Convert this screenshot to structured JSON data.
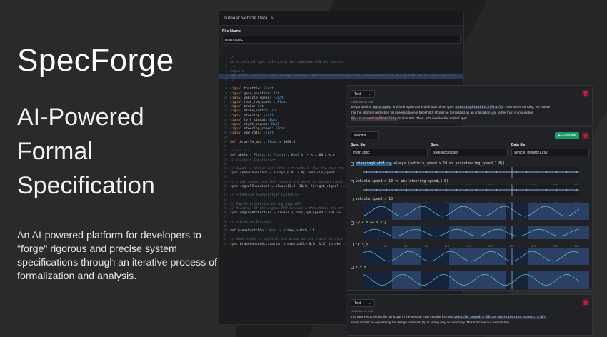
{
  "hero": {
    "title": "SpecForge",
    "tagline_lines": [
      "AI-Powered",
      "Formal",
      "Specification"
    ],
    "description": "An AI-powered platform for developers to \"forge\" rigorous and precise system specifications through an iterative process of formalization and analysis."
  },
  "editor": {
    "tab_title": "Tutorial: Vehicle Data",
    "file_name_label": "File Name",
    "file_name_value": "main.spec",
    "code_lines": [
      {
        "n": "1",
        "parts": [
          [
            "cm",
            "/*"
          ]
        ]
      },
      {
        "n": "2",
        "parts": [
          [
            "cm",
            "An artificial spec file using the nuScenes CAN bus dataset."
          ]
        ]
      },
      {
        "n": "3",
        "parts": [
          [
            "cm",
            "..."
          ]
        ]
      },
      {
        "n": "4",
        "parts": [
          [
            "cm",
            "Signals"
          ]
        ]
      },
      {
        "n": "5",
        "parts": [
          [
            "cm",
            "see https://github.com/nutonomy/nuscenes-devkit/blob/master/python-sdk/nuscenes/can_bus/README.md for more details"
          ]
        ],
        "hl": true
      },
      {
        "n": "6",
        "parts": [
          [
            "cm",
            "*/"
          ]
        ]
      },
      {
        "n": "7",
        "parts": [
          [
            "tx",
            ""
          ]
        ]
      },
      {
        "n": "8",
        "parts": [
          [
            "kw",
            "signal "
          ],
          [
            "tx",
            "throttle: "
          ],
          [
            "ty",
            "Float"
          ]
        ]
      },
      {
        "n": "9",
        "parts": [
          [
            "kw",
            "signal "
          ],
          [
            "tx",
            "gear_position: "
          ],
          [
            "ty",
            "Int"
          ]
        ]
      },
      {
        "n": "10",
        "parts": [
          [
            "kw",
            "signal "
          ],
          [
            "tx",
            "vehicle_speed: "
          ],
          [
            "ty",
            "Float"
          ]
        ]
      },
      {
        "n": "11",
        "parts": [
          [
            "kw",
            "signal "
          ],
          [
            "tx",
            "rear_rpm_speed : "
          ],
          [
            "ty",
            "Float"
          ]
        ]
      },
      {
        "n": "12",
        "parts": [
          [
            "kw",
            "signal "
          ],
          [
            "tx",
            "brake: "
          ],
          [
            "ty",
            "Int"
          ]
        ]
      },
      {
        "n": "13",
        "parts": [
          [
            "kw",
            "signal "
          ],
          [
            "tx",
            "brake_switch: "
          ],
          [
            "ty",
            "Int"
          ]
        ]
      },
      {
        "n": "14",
        "parts": [
          [
            "kw",
            "signal "
          ],
          [
            "tx",
            "steering: "
          ],
          [
            "ty",
            "Float"
          ]
        ]
      },
      {
        "n": "15",
        "parts": [
          [
            "kw",
            "signal "
          ],
          [
            "tx",
            "left_signal: "
          ],
          [
            "ty",
            "Bool"
          ]
        ]
      },
      {
        "n": "16",
        "parts": [
          [
            "kw",
            "signal "
          ],
          [
            "tx",
            "right_signal: "
          ],
          [
            "ty",
            "Bool"
          ]
        ]
      },
      {
        "n": "17",
        "parts": [
          [
            "kw",
            "signal "
          ],
          [
            "tx",
            "steering_speed: "
          ],
          [
            "ty",
            "Float"
          ]
        ]
      },
      {
        "n": "18",
        "parts": [
          [
            "kw",
            "signal "
          ],
          [
            "tx",
            "yaw_rate: "
          ],
          [
            "ty",
            "Float"
          ]
        ]
      },
      {
        "n": "19",
        "parts": [
          [
            "tx",
            ""
          ]
        ]
      },
      {
        "n": "20",
        "parts": [
          [
            "kw",
            "def "
          ],
          [
            "tx",
            "throttle_max : "
          ],
          [
            "ty",
            "Float"
          ],
          [
            "tx",
            " = 1000.0"
          ]
        ]
      },
      {
        "n": "21",
        "parts": [
          [
            "tx",
            ""
          ]
        ]
      },
      {
        "n": "22",
        "parts": [
          [
            "cm",
            "// lcf = x"
          ]
        ]
      },
      {
        "n": "23",
        "parts": [
          [
            "kw",
            "def "
          ],
          [
            "tx",
            "abslx : "
          ],
          [
            "ty",
            "Float"
          ],
          [
            "tx",
            ", y: "
          ],
          [
            "ty",
            "Float"
          ],
          [
            "tx",
            ") : "
          ],
          [
            "ty",
            "Bool"
          ],
          [
            "tx",
            " = -y < x && x < y"
          ]
        ]
      },
      {
        "n": "24",
        "parts": [
          [
            "cm",
            "// <<Simple Invariant>>"
          ]
        ]
      },
      {
        "n": "25",
        "parts": [
          [
            "tx",
            ""
          ]
        ]
      },
      {
        "n": "26",
        "parts": [
          [
            "cm",
            "// Speed is always less than a threshold, for the next ten..."
          ]
        ]
      },
      {
        "n": "27",
        "parts": [
          [
            "kw",
            "spec "
          ],
          [
            "tx",
            "speedInvariant = always[0.0, 2.0] (vehicle_speed ..."
          ]
        ]
      },
      {
        "n": "28",
        "parts": [
          [
            "tx",
            ""
          ]
        ]
      },
      {
        "n": "29",
        "parts": [
          [
            "cm",
            "// right signal and left signal are never triggered simult..."
          ]
        ]
      },
      {
        "n": "30",
        "parts": [
          [
            "kw",
            "spec "
          ],
          [
            "tx",
            "signalInvariant = always[0.0, 10.0] !(right_signal ..."
          ]
        ]
      },
      {
        "n": "31",
        "parts": [
          [
            "tx",
            ""
          ]
        ]
      },
      {
        "n": "32",
        "parts": [
          [
            "cm",
            "// <<Vehicle Acceleration Control>>"
          ]
        ]
      },
      {
        "n": "33",
        "parts": [
          [
            "tx",
            ""
          ]
        ]
      },
      {
        "n": "34",
        "parts": [
          [
            "cm",
            "// Engine Protection During High RPM"
          ]
        ]
      },
      {
        "n": "35",
        "parts": [
          [
            "cm",
            "// Meaning: If the engine RPM exceeds a threshold, the thr..."
          ]
        ]
      },
      {
        "n": "36",
        "parts": [
          [
            "kw",
            "spec "
          ],
          [
            "tx",
            "engineProtection = always ((rear_rpm_speed > 10) =>..."
          ]
        ]
      },
      {
        "n": "37",
        "parts": [
          [
            "tx",
            ""
          ]
        ]
      },
      {
        "n": "38",
        "parts": [
          [
            "cm",
            "// <<Braking System>>"
          ]
        ]
      },
      {
        "n": "39",
        "parts": [
          [
            "tx",
            ""
          ]
        ]
      },
      {
        "n": "40",
        "parts": [
          [
            "kw",
            "def "
          ],
          [
            "tx",
            "breakSwitchOn : "
          ],
          [
            "ty",
            "Bool"
          ],
          [
            "tx",
            " = brake_switch : 1"
          ]
        ]
      },
      {
        "n": "41",
        "parts": [
          [
            "tx",
            ""
          ]
        ]
      },
      {
        "n": "42",
        "parts": [
          [
            "cm",
            "// When brake is applied, the brake switch status is also ..."
          ]
        ]
      },
      {
        "n": "43",
        "parts": [
          [
            "kw",
            "spec "
          ],
          [
            "tx",
            "brakeSensorActivation = eventually[0.0, 1.0] (brake ..."
          ]
        ]
      }
    ]
  },
  "text_panel_1": {
    "mode": "Text",
    "hint": "(Click Text to Edit)",
    "line1_a": "We go back to ",
    "chip1": "main.spec",
    "line1_b": " and look again at the definition of the spec ",
    "chip2": "steeringStability(?rail)",
    "line1_c": ". After some thinking, we realize",
    "line2_a": "that the informal restriction \"at speeds above a threshold\" should be formalized as an implication ",
    "chip3": "=>",
    "line2_b": " rather than a conjunction",
    "chip4": "&& in steeringStability",
    "line2_c": " in Line 685. Then, let's monitor the refined spec."
  },
  "monitor": {
    "mode": "Monitor",
    "evaluate_label": "Evaluate",
    "spec_file_label": "Spec file",
    "spec_file_value": "main.spec",
    "spec_label": "Spec",
    "spec_value": "steeringStability",
    "data_file_label": "Data file",
    "data_file_value": "vehicle_monitor1.csv",
    "traces": [
      {
        "chip": "steeringStability",
        "formula": "always (vehicle_speed > 10 => abs(steering_speed,1.0))"
      },
      {
        "formula": "vehicle_speed > 10 => abs(steering_speed,1.0)"
      },
      {
        "formula": "vehicle_speed > 10"
      },
      {
        "formula": "-y < x && x < y"
      },
      {
        "formula": "-y < x"
      },
      {
        "formula": "x < y"
      }
    ],
    "ticks": [
      "0.0",
      "2.5",
      "5.0",
      "7.5",
      "10.0",
      "12.5",
      "15.0",
      "17.5",
      "20.0",
      "22.5",
      "25.0"
    ]
  },
  "text_panel_2": {
    "mode": "Text",
    "hint": "(Click Text to Edit)",
    "line1_a": "The new result shows (in particular in the second row) that the formula ",
    "chip1": "vehicle_speed > 10 => abs(steering_speed, 1.0)",
    "line1_b": ",",
    "line2": "which should be expressing the design intension (*), is failing only occasionally. This matches our expectation."
  }
}
